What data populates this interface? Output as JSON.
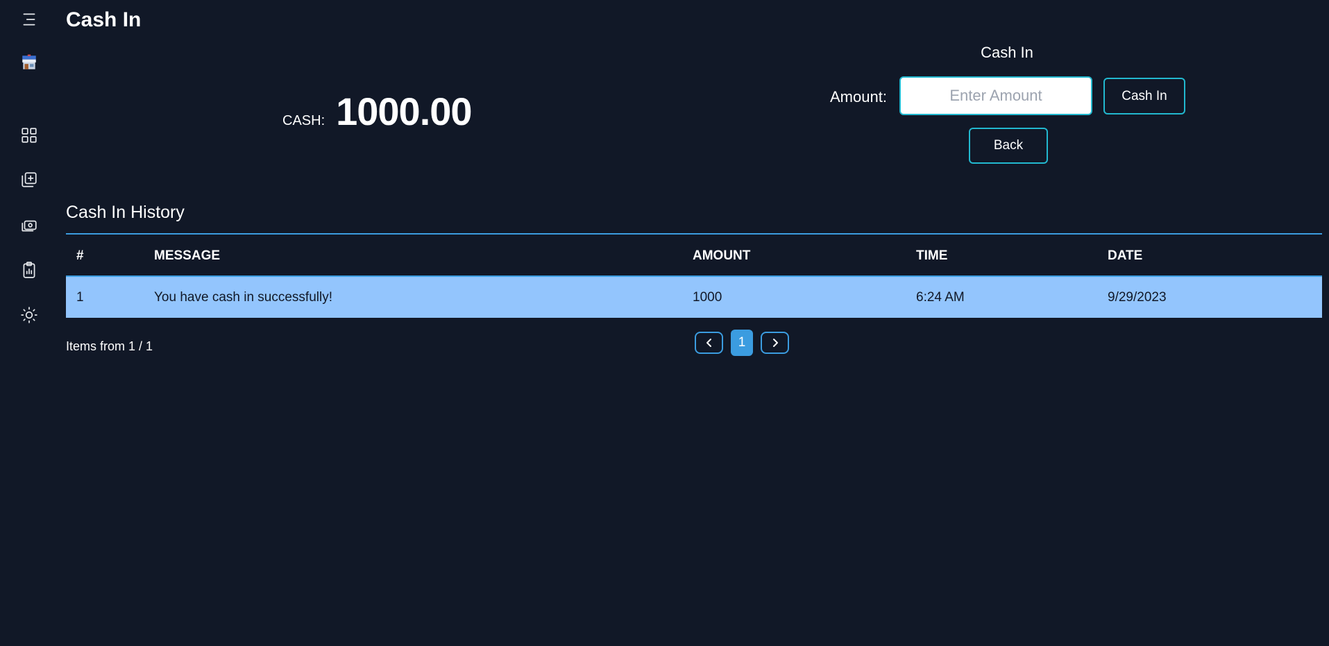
{
  "header": {
    "title": "Cash In"
  },
  "sidebar": {
    "items": [
      {
        "icon": "menu-icon"
      },
      {
        "icon": "store-icon"
      },
      {
        "icon": "dashboard-icon"
      },
      {
        "icon": "add-product-icon"
      },
      {
        "icon": "cash-icon"
      },
      {
        "icon": "report-clipboard-icon"
      },
      {
        "icon": "theme-sun-icon"
      }
    ]
  },
  "balance": {
    "label": "CASH:",
    "value": "1000.00"
  },
  "cash_in_form": {
    "title": "Cash In",
    "amount_label": "Amount:",
    "amount_placeholder": "Enter Amount",
    "amount_value": "",
    "submit_label": "Cash In",
    "back_label": "Back"
  },
  "history": {
    "title": "Cash In History",
    "columns": [
      "#",
      "MESSAGE",
      "AMOUNT",
      "TIME",
      "DATE"
    ],
    "rows": [
      {
        "num": "1",
        "message": "You have cash in successfully!",
        "amount": "1000",
        "time": "6:24 AM",
        "date": "9/29/2023"
      }
    ],
    "items_info": "Items from 1 / 1",
    "current_page": "1"
  },
  "colors": {
    "background": "#111827",
    "accent": "#22b8cf",
    "row_highlight": "#93c5fd",
    "pager_blue": "#3b9ce0"
  }
}
